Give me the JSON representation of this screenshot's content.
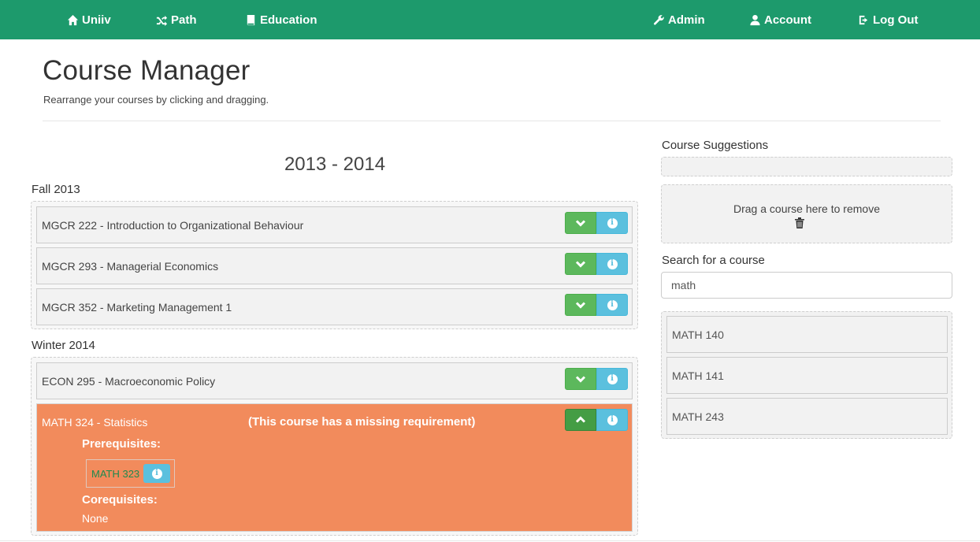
{
  "nav": {
    "uniiv": {
      "label": "Uniiv",
      "icon": "home-icon"
    },
    "path": {
      "label": "Path",
      "icon": "shuffle-icon"
    },
    "education": {
      "label": "Education",
      "icon": "book-icon"
    },
    "admin": {
      "label": "Admin",
      "icon": "wrench-icon"
    },
    "account": {
      "label": "Account",
      "icon": "user-icon"
    },
    "logout": {
      "label": "Log Out",
      "icon": "log-out-icon"
    }
  },
  "header": {
    "title": "Course Manager",
    "subtitle": "Rearrange your courses by clicking and dragging."
  },
  "year": "2013 - 2014",
  "terms": [
    {
      "name": "Fall 2013",
      "courses": [
        {
          "label": "MGCR 222 - Introduction to Organizational Behaviour"
        },
        {
          "label": "MGCR 293 - Managerial Economics"
        },
        {
          "label": "MGCR 352 - Marketing Management 1"
        }
      ]
    },
    {
      "name": "Winter 2014",
      "courses": [
        {
          "label": "ECON 295 - Macroeconomic Policy"
        },
        {
          "label": "MATH 324 - Statistics",
          "warning": "(This course has a missing requirement)",
          "prerequisites_heading": "Prerequisites:",
          "prerequisites": [
            "MATH 323"
          ],
          "corequisites_heading": "Corequisites:",
          "corequisites_value": "None"
        }
      ]
    }
  ],
  "sidebar": {
    "suggestions_heading": "Course Suggestions",
    "remove_zone_text": "Drag a course here to remove",
    "search_heading": "Search for a course",
    "search_value": "math",
    "results": [
      "MATH 140",
      "MATH 141",
      "MATH 243"
    ]
  },
  "colors": {
    "navbar": "#1d9a6c",
    "expand_button": "#5cb85c",
    "info_button": "#5bc0de",
    "missing_requirement": "#f28b5c"
  }
}
